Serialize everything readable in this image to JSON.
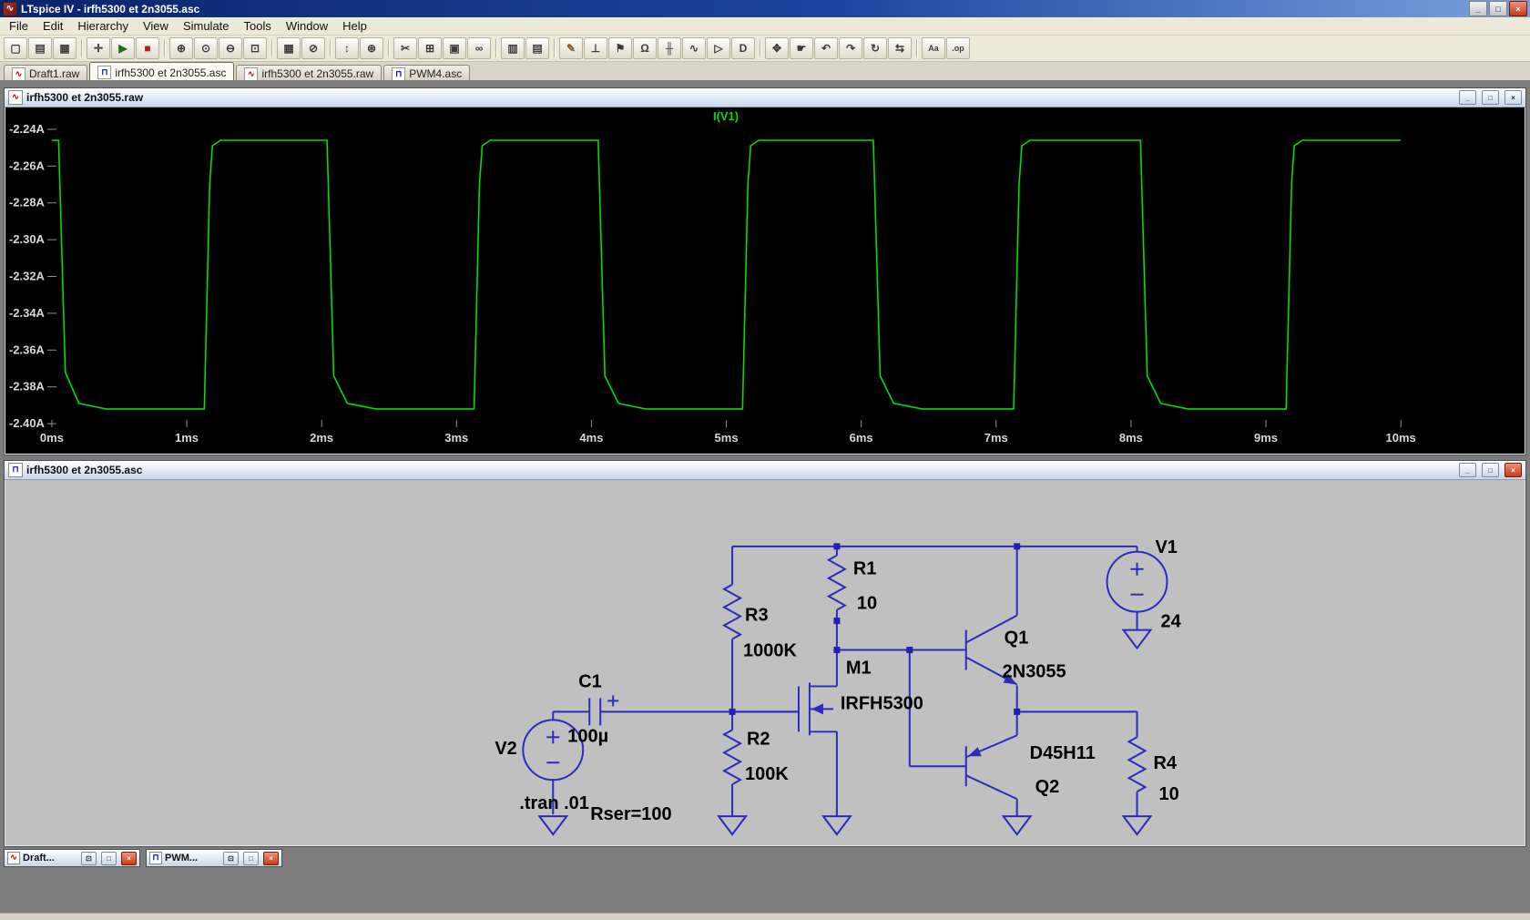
{
  "app": {
    "title": "LTspice IV - irfh5300 et 2n3055.asc"
  },
  "icons": {
    "minimize": "_",
    "maximize": "□",
    "restore": "⊡",
    "close": "×",
    "raw_file": "∿",
    "asc_file": "⊓",
    "app": "∿"
  },
  "menu": {
    "items": [
      "File",
      "Edit",
      "Hierarchy",
      "View",
      "Simulate",
      "Tools",
      "Window",
      "Help"
    ]
  },
  "toolbar": {
    "items": [
      {
        "name": "new-schematic",
        "glyph": "▢"
      },
      {
        "name": "open-file",
        "glyph": "▤"
      },
      {
        "name": "save",
        "glyph": "▦"
      },
      {
        "sep": true
      },
      {
        "name": "control-panel",
        "glyph": "✛"
      },
      {
        "name": "run-simulation",
        "glyph": "▶",
        "color": "#1d6e1d"
      },
      {
        "name": "halt-simulation",
        "glyph": "■",
        "color": "#b02020"
      },
      {
        "sep": true
      },
      {
        "name": "zoom-in",
        "glyph": "⊕"
      },
      {
        "name": "zoom-back",
        "glyph": "⊙"
      },
      {
        "name": "zoom-out",
        "glyph": "⊖"
      },
      {
        "name": "zoom-full-extents",
        "glyph": "⊡"
      },
      {
        "sep": true
      },
      {
        "name": "show-grid",
        "glyph": "▦"
      },
      {
        "name": "mark-unconnected-nodes",
        "glyph": "⊘"
      },
      {
        "sep": true
      },
      {
        "name": "autorange-y-axis",
        "glyph": "↕"
      },
      {
        "name": "plot-settings",
        "glyph": "⊛"
      },
      {
        "sep": true
      },
      {
        "name": "cut",
        "glyph": "✂"
      },
      {
        "name": "copy",
        "glyph": "⊞"
      },
      {
        "name": "paste",
        "glyph": "▣"
      },
      {
        "name": "find",
        "glyph": "∞"
      },
      {
        "sep": true
      },
      {
        "name": "print-preview",
        "glyph": "▥"
      },
      {
        "name": "print",
        "glyph": "▤"
      },
      {
        "sep": true
      },
      {
        "name": "draw-wire",
        "glyph": "✎",
        "color": "#8a5a1a"
      },
      {
        "name": "place-ground",
        "glyph": "⊥"
      },
      {
        "name": "label-net",
        "glyph": "⚑"
      },
      {
        "name": "place-resistor",
        "glyph": "Ω"
      },
      {
        "name": "place-capacitor",
        "glyph": "╫"
      },
      {
        "name": "place-inductor",
        "glyph": "∿"
      },
      {
        "name": "place-diode",
        "glyph": "▷"
      },
      {
        "name": "place-component",
        "glyph": "D"
      },
      {
        "sep": true
      },
      {
        "name": "move",
        "glyph": "✥"
      },
      {
        "name": "drag",
        "glyph": "☛"
      },
      {
        "name": "undo",
        "glyph": "↶"
      },
      {
        "name": "redo",
        "glyph": "↷"
      },
      {
        "name": "rotate",
        "glyph": "↻"
      },
      {
        "name": "mirror",
        "glyph": "⇆"
      },
      {
        "sep": true
      },
      {
        "name": "add-text",
        "glyph": "Aa"
      },
      {
        "name": "spice-directive",
        "glyph": ".op"
      }
    ]
  },
  "tabs": [
    {
      "label": "Draft1.raw",
      "type": "raw",
      "active": false
    },
    {
      "label": "irfh5300 et 2n3055.asc",
      "type": "asc",
      "active": true
    },
    {
      "label": "irfh5300 et 2n3055.raw",
      "type": "raw",
      "active": false
    },
    {
      "label": "PWM4.asc",
      "type": "asc",
      "active": false
    }
  ],
  "waveform": {
    "title": "irfh5300 et 2n3055.raw"
  },
  "chart_data": {
    "type": "line",
    "title": "I(V1)",
    "legend": [
      "I(V1)"
    ],
    "background": "#000000",
    "grid": false,
    "xlim": [
      0,
      10
    ],
    "x_unit": "ms",
    "ylim": [
      -2.4,
      -2.24
    ],
    "y_unit": "A",
    "xticks": [
      {
        "v": 0,
        "label": "0ms"
      },
      {
        "v": 1,
        "label": "1ms"
      },
      {
        "v": 2,
        "label": "2ms"
      },
      {
        "v": 3,
        "label": "3ms"
      },
      {
        "v": 4,
        "label": "4ms"
      },
      {
        "v": 5,
        "label": "5ms"
      },
      {
        "v": 6,
        "label": "6ms"
      },
      {
        "v": 7,
        "label": "7ms"
      },
      {
        "v": 8,
        "label": "8ms"
      },
      {
        "v": 9,
        "label": "9ms"
      },
      {
        "v": 10,
        "label": "10ms"
      }
    ],
    "yticks": [
      {
        "v": -2.24,
        "label": "-2.24A"
      },
      {
        "v": -2.26,
        "label": "-2.26A"
      },
      {
        "v": -2.28,
        "label": "-2.28A"
      },
      {
        "v": -2.3,
        "label": "-2.30A"
      },
      {
        "v": -2.32,
        "label": "-2.32A"
      },
      {
        "v": -2.34,
        "label": "-2.34A"
      },
      {
        "v": -2.36,
        "label": "-2.36A"
      },
      {
        "v": -2.38,
        "label": "-2.38A"
      },
      {
        "v": -2.4,
        "label": "-2.40A"
      }
    ],
    "waveform_summary": {
      "shape": "square",
      "high_A": -2.246,
      "low_A": -2.392,
      "period_ms": 2.0,
      "first_rise_ms": 1.15
    },
    "series": [
      {
        "name": "I(V1)",
        "color": "#00dd00",
        "points": [
          [
            0,
            -2.246
          ],
          [
            0.05,
            -2.246
          ],
          [
            0.1,
            -2.372
          ],
          [
            0.2,
            -2.389
          ],
          [
            0.4,
            -2.392
          ],
          [
            1.13,
            -2.392
          ],
          [
            1.17,
            -2.27
          ],
          [
            1.19,
            -2.249
          ],
          [
            1.25,
            -2.246
          ],
          [
            2.04,
            -2.246
          ],
          [
            2.09,
            -2.374
          ],
          [
            2.19,
            -2.389
          ],
          [
            2.4,
            -2.392
          ],
          [
            3.13,
            -2.392
          ],
          [
            3.17,
            -2.27
          ],
          [
            3.19,
            -2.249
          ],
          [
            3.25,
            -2.246
          ],
          [
            4.05,
            -2.246
          ],
          [
            4.1,
            -2.374
          ],
          [
            4.2,
            -2.389
          ],
          [
            4.4,
            -2.392
          ],
          [
            5.12,
            -2.392
          ],
          [
            5.16,
            -2.27
          ],
          [
            5.18,
            -2.249
          ],
          [
            5.24,
            -2.246
          ],
          [
            6.09,
            -2.246
          ],
          [
            6.14,
            -2.374
          ],
          [
            6.24,
            -2.389
          ],
          [
            6.45,
            -2.392
          ],
          [
            7.13,
            -2.392
          ],
          [
            7.17,
            -2.27
          ],
          [
            7.19,
            -2.249
          ],
          [
            7.25,
            -2.246
          ],
          [
            8.07,
            -2.246
          ],
          [
            8.12,
            -2.374
          ],
          [
            8.22,
            -2.389
          ],
          [
            8.42,
            -2.392
          ],
          [
            9.15,
            -2.392
          ],
          [
            9.19,
            -2.27
          ],
          [
            9.21,
            -2.249
          ],
          [
            9.27,
            -2.246
          ],
          [
            10,
            -2.246
          ]
        ]
      }
    ]
  },
  "schematic": {
    "title": "irfh5300 et 2n3055.asc",
    "components": {
      "R1": {
        "name": "R1",
        "value": "10"
      },
      "R2": {
        "name": "R2",
        "value": "100K"
      },
      "R3": {
        "name": "R3",
        "value": "1000K"
      },
      "R4": {
        "name": "R4",
        "value": "10"
      },
      "C1": {
        "name": "C1",
        "value": "100µ"
      },
      "V1": {
        "name": "V1",
        "value": "24"
      },
      "V2": {
        "name": "V2"
      },
      "M1": {
        "name": "M1",
        "value": "IRFH5300"
      },
      "Q1": {
        "name": "Q1",
        "value": "2N3055"
      },
      "Q2": {
        "name": "Q2",
        "value": "D45H11"
      }
    },
    "directives": {
      "tran": ".tran .01",
      "rser": "Rser=100"
    }
  },
  "minimized": [
    {
      "title": "Draft...",
      "type": "raw"
    },
    {
      "title": "PWM...",
      "type": "asc"
    }
  ]
}
